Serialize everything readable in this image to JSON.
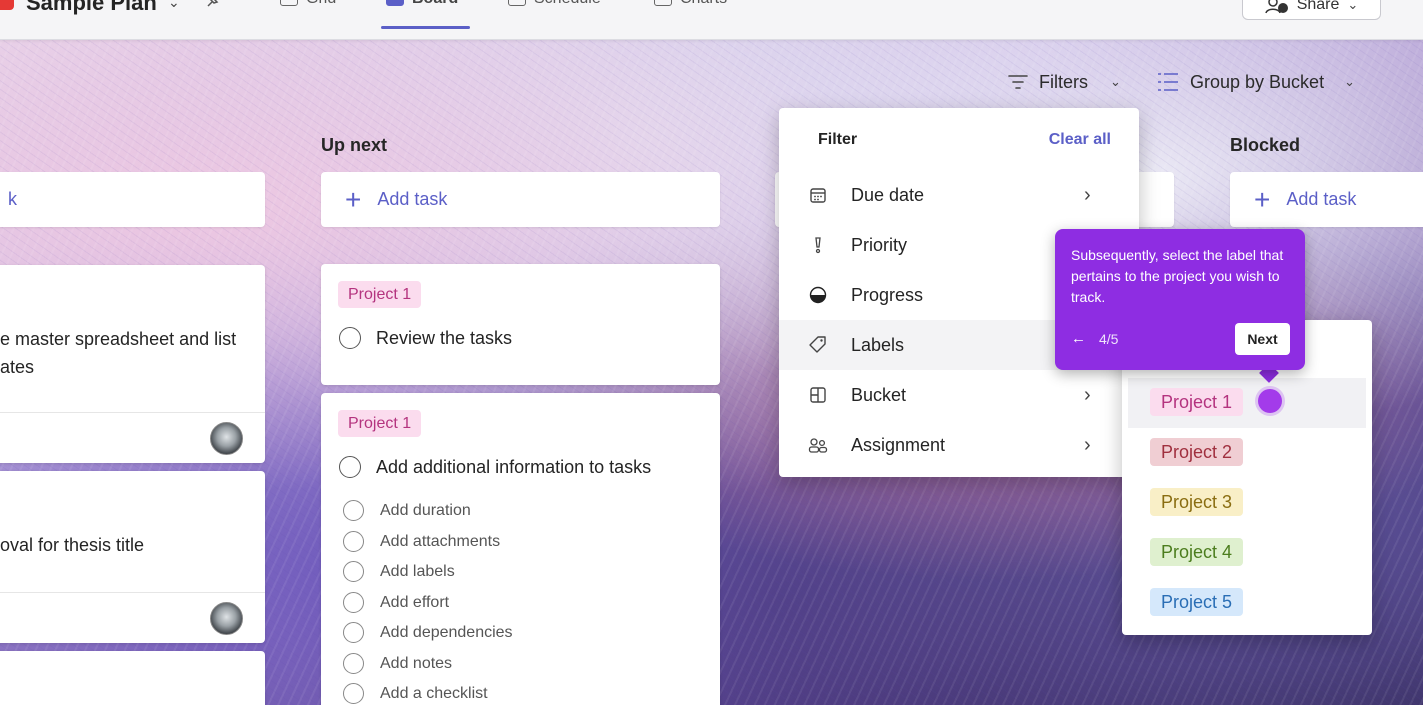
{
  "header": {
    "plan_title": "Sample Plan",
    "tabs": [
      {
        "label": "Grid"
      },
      {
        "label": "Board"
      },
      {
        "label": "Schedule"
      },
      {
        "label": "Charts"
      }
    ],
    "active_tab": "Board",
    "share_label": "Share"
  },
  "toolbar": {
    "filters_label": "Filters",
    "group_by_label": "Group by Bucket"
  },
  "columns": [
    {
      "title": "",
      "add_task": "k"
    },
    {
      "title": "Up next",
      "add_task": "Add task"
    },
    {
      "title": "Blocked",
      "add_task": "Add task"
    }
  ],
  "left_cards": [
    {
      "line1": "e master spreadsheet and list",
      "line2": "ates"
    },
    {
      "line1": "oval for thesis title"
    }
  ],
  "up_next_cards": [
    {
      "label": "Project 1",
      "title": "Review the tasks"
    },
    {
      "label": "Project 1",
      "title": "Add additional information to tasks",
      "checklist": [
        "Add duration",
        "Add attachments",
        "Add labels",
        "Add effort",
        "Add dependencies",
        "Add notes",
        "Add a checklist"
      ]
    }
  ],
  "filter_panel": {
    "heading": "Filter",
    "clear_all": "Clear all",
    "items": [
      {
        "label": "Due date",
        "icon": "calendar-icon"
      },
      {
        "label": "Priority",
        "icon": "priority-icon"
      },
      {
        "label": "Progress",
        "icon": "progress-icon"
      },
      {
        "label": "Labels",
        "icon": "tag-icon"
      },
      {
        "label": "Bucket",
        "icon": "bucket-icon"
      },
      {
        "label": "Assignment",
        "icon": "people-icon"
      }
    ]
  },
  "labels_menu": {
    "items": [
      {
        "label": "Project 1",
        "bg": "#fbdcee",
        "fg": "#b4347f"
      },
      {
        "label": "Project 2",
        "bg": "#f0ced3",
        "fg": "#a0303f"
      },
      {
        "label": "Project 3",
        "bg": "#f9efc7",
        "fg": "#8a6d11"
      },
      {
        "label": "Project 4",
        "bg": "#dff0cf",
        "fg": "#4c7d1e"
      },
      {
        "label": "Project 5",
        "bg": "#d5e8fb",
        "fg": "#2a6eb5"
      }
    ]
  },
  "tooltip": {
    "text": "Subsequently, select the label that pertains to the project you wish to track.",
    "step": "4/5",
    "next_label": "Next",
    "color": "#8e2de2"
  },
  "colors": {
    "accent": "#5b5fc7",
    "label_project1_bg": "#fbdcee",
    "label_project1_fg": "#b4347f"
  }
}
